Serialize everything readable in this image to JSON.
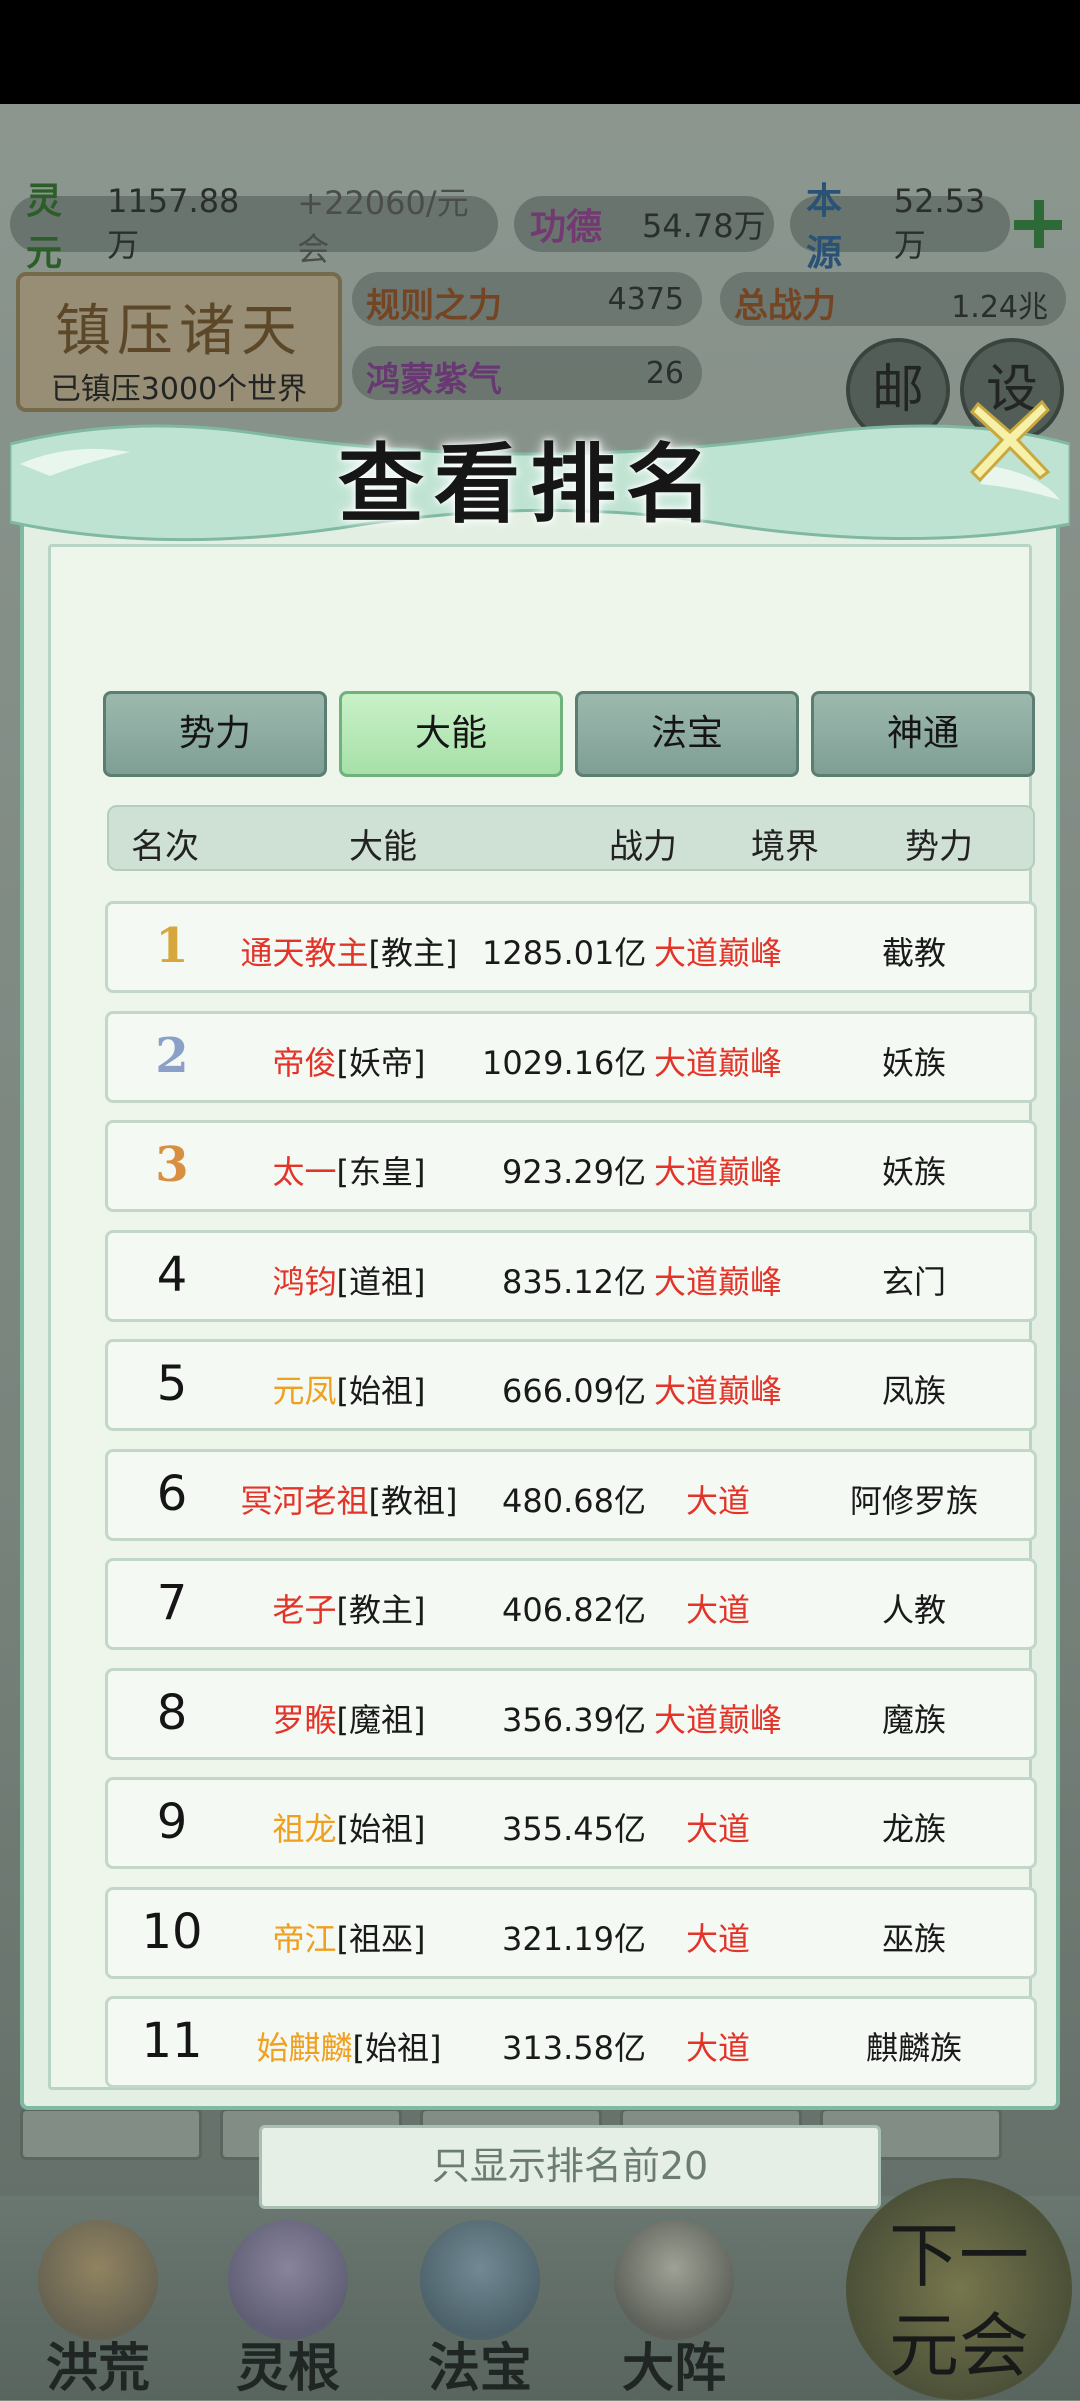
{
  "resources": {
    "lingyuan": {
      "name": "灵元",
      "value": "1157.88万",
      "rate": "+22060/元会"
    },
    "gongde": {
      "name": "功德",
      "value": "54.78万"
    },
    "benyuan": {
      "name": "本源",
      "value": "52.53万"
    }
  },
  "zhenya": {
    "title": "镇压诸天",
    "subtitle": "已镇压3000个世界"
  },
  "stats": {
    "guize": {
      "name": "规则之力",
      "value": "4375"
    },
    "zongzhanli": {
      "name": "总战力",
      "value": "1.24兆"
    },
    "third": {
      "name": "鸿蒙紫气",
      "value": "26"
    }
  },
  "side_buttons": {
    "mail": "邮",
    "settings": "设"
  },
  "modal": {
    "title": "查看排名",
    "tabs": [
      {
        "label": "势力",
        "active": false
      },
      {
        "label": "大能",
        "active": true
      },
      {
        "label": "法宝",
        "active": false
      },
      {
        "label": "神通",
        "active": false
      }
    ],
    "columns": {
      "rank": "名次",
      "name": "大能",
      "power": "战力",
      "realm": "境界",
      "faction": "势力"
    },
    "rows": [
      {
        "rank": "1",
        "name": "通天教主",
        "name_color": "#e3342a",
        "title": "[教主]",
        "power": "1285.01亿",
        "realm": "大道巅峰",
        "faction": "截教"
      },
      {
        "rank": "2",
        "name": "帝俊",
        "name_color": "#e3342a",
        "title": "[妖帝]",
        "power": "1029.16亿",
        "realm": "大道巅峰",
        "faction": "妖族"
      },
      {
        "rank": "3",
        "name": "太一",
        "name_color": "#e3342a",
        "title": "[东皇]",
        "power": "923.29亿",
        "realm": "大道巅峰",
        "faction": "妖族"
      },
      {
        "rank": "4",
        "name": "鸿钧",
        "name_color": "#e3342a",
        "title": "[道祖]",
        "power": "835.12亿",
        "realm": "大道巅峰",
        "faction": "玄门"
      },
      {
        "rank": "5",
        "name": "元凤",
        "name_color": "#f0a020",
        "title": "[始祖]",
        "power": "666.09亿",
        "realm": "大道巅峰",
        "faction": "凤族"
      },
      {
        "rank": "6",
        "name": "冥河老祖",
        "name_color": "#e3342a",
        "title": "[教祖]",
        "power": "480.68亿",
        "realm": "大道",
        "faction": "阿修罗族"
      },
      {
        "rank": "7",
        "name": "老子",
        "name_color": "#e3342a",
        "title": "[教主]",
        "power": "406.82亿",
        "realm": "大道",
        "faction": "人教"
      },
      {
        "rank": "8",
        "name": "罗睺",
        "name_color": "#e3342a",
        "title": "[魔祖]",
        "power": "356.39亿",
        "realm": "大道巅峰",
        "faction": "魔族"
      },
      {
        "rank": "9",
        "name": "祖龙",
        "name_color": "#f0a020",
        "title": "[始祖]",
        "power": "355.45亿",
        "realm": "大道",
        "faction": "龙族"
      },
      {
        "rank": "10",
        "name": "帝江",
        "name_color": "#f0a020",
        "title": "[祖巫]",
        "power": "321.19亿",
        "realm": "大道",
        "faction": "巫族"
      },
      {
        "rank": "11",
        "name": "始麒麟",
        "name_color": "#f0a020",
        "title": "[始祖]",
        "power": "313.58亿",
        "realm": "大道",
        "faction": "麒麟族"
      }
    ],
    "show_top_button": "只显示排名前20"
  },
  "bottom_nav": [
    {
      "label": "洪荒"
    },
    {
      "label": "灵根"
    },
    {
      "label": "法宝"
    },
    {
      "label": "大阵"
    }
  ],
  "next_era": {
    "line1": "下一",
    "line2": "元会"
  },
  "colors": {
    "accent_green": "#a6e0a8",
    "realm_red": "#e3342a",
    "name_orange": "#f0a020"
  }
}
